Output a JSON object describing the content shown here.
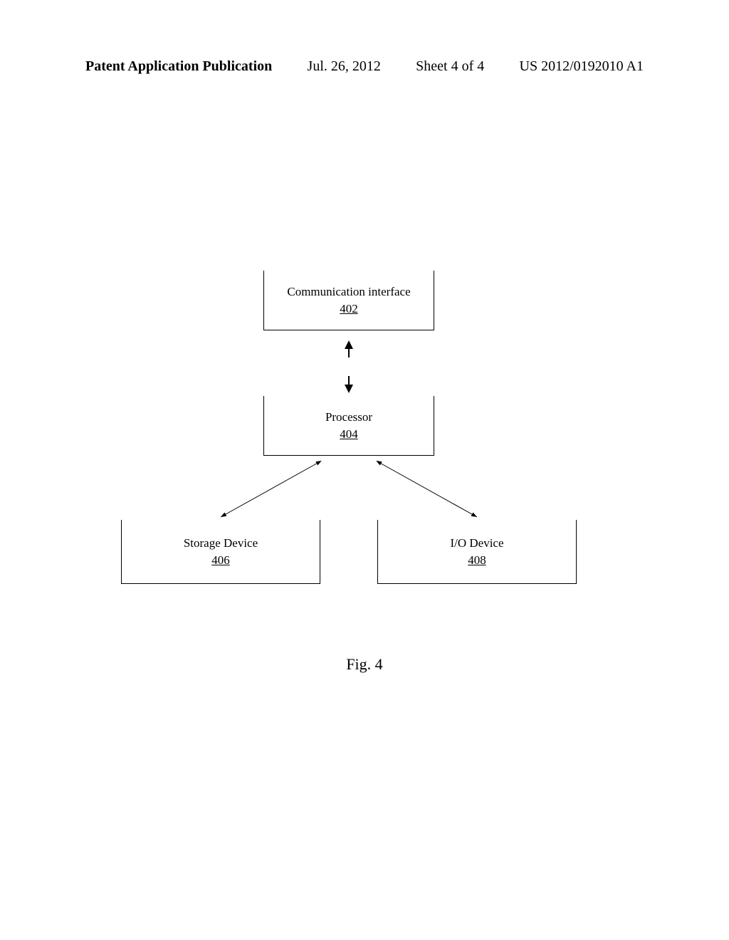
{
  "header": {
    "publication_label": "Patent Application Publication",
    "date": "Jul. 26, 2012",
    "sheet": "Sheet 4 of 4",
    "doc_number": "US 2012/0192010 A1"
  },
  "blocks": {
    "comm": {
      "label": "Communication interface",
      "ref": "402"
    },
    "proc": {
      "label": "Processor",
      "ref": "404"
    },
    "storage": {
      "label": "Storage Device",
      "ref": "406"
    },
    "io": {
      "label": "I/O Device",
      "ref": "408"
    }
  },
  "figure_caption": "Fig. 4"
}
